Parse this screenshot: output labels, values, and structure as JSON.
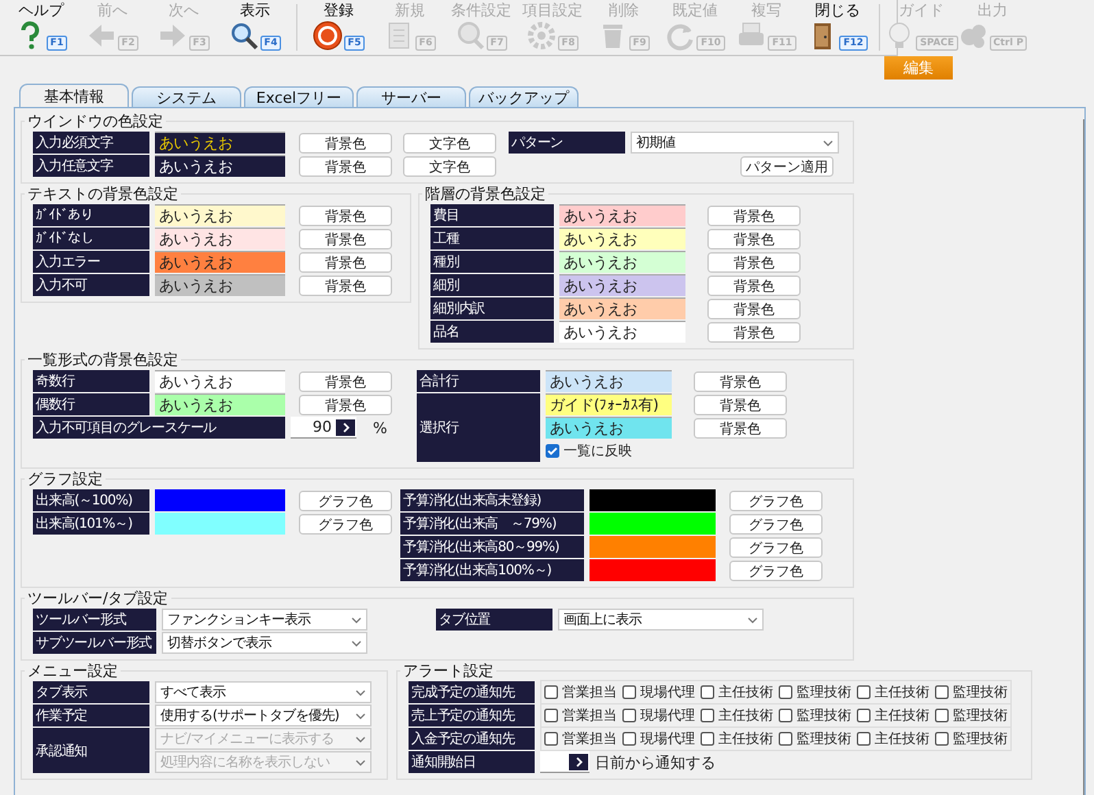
{
  "toolbar": {
    "groups": [
      [
        {
          "label": "ヘルプ",
          "key": "F1",
          "kind": "help",
          "disabled": false
        },
        {
          "label": "前へ",
          "key": "F2",
          "kind": "back",
          "disabled": true
        },
        {
          "label": "次へ",
          "key": "F3",
          "kind": "forward",
          "disabled": true
        },
        {
          "label": "表示",
          "key": "F4",
          "kind": "search",
          "disabled": false
        }
      ],
      [
        {
          "label": "登録",
          "key": "F5",
          "kind": "ok",
          "disabled": false
        },
        {
          "label": "新規",
          "key": "F6",
          "kind": "document",
          "disabled": true
        },
        {
          "label": "条件設定",
          "key": "F7",
          "kind": "filter",
          "disabled": true
        },
        {
          "label": "項目設定",
          "key": "F8",
          "kind": "gear",
          "disabled": true
        },
        {
          "label": "削除",
          "key": "F9",
          "kind": "trash",
          "disabled": true
        },
        {
          "label": "既定値",
          "key": "F10",
          "kind": "refresh",
          "disabled": true
        },
        {
          "label": "複写",
          "key": "F11",
          "kind": "copy",
          "disabled": true
        },
        {
          "label": "閉じる",
          "key": "F12",
          "kind": "close",
          "disabled": false
        }
      ],
      [
        {
          "label": "ガイド",
          "key": "SPACE",
          "kind": "bulb",
          "disabled": true
        },
        {
          "label": "出力",
          "key": "Ctrl P",
          "kind": "output",
          "disabled": true
        }
      ]
    ]
  },
  "mode_button": "編集",
  "tabs": [
    {
      "label": "基本情報",
      "selected": true
    },
    {
      "label": "システム",
      "selected": false
    },
    {
      "label": "Excelフリー",
      "selected": false
    },
    {
      "label": "サーバー",
      "selected": false
    },
    {
      "label": "バックアップ",
      "selected": false
    }
  ],
  "window_colors": {
    "title": "ウインドウの色設定",
    "rows": [
      {
        "label": "入力必須文字",
        "sample": "あいうえお",
        "kind": "required",
        "buttons": [
          "背景色",
          "文字色"
        ]
      },
      {
        "label": "入力任意文字",
        "sample": "あいうえお",
        "kind": "optional",
        "buttons": [
          "背景色",
          "文字色"
        ]
      }
    ],
    "pattern": {
      "label": "パターン",
      "value": "初期値",
      "apply": "パターン適用"
    }
  },
  "text_colors": {
    "title": "テキストの背景色設定",
    "rows": [
      {
        "label": "ｶﾞｲﾄﾞあり",
        "sample": "あいうえお",
        "color": "#fff8cc",
        "button": "背景色"
      },
      {
        "label": "ｶﾞｲﾄﾞなし",
        "sample": "あいうえお",
        "color": "#ffe4e4",
        "button": "背景色"
      },
      {
        "label": "入力エラー",
        "sample": "あいうえお",
        "color": "#ff8040",
        "button": "背景色"
      },
      {
        "label": "入力不可",
        "sample": "あいうえお",
        "color": "#c0c0c0",
        "button": "背景色"
      }
    ]
  },
  "level_colors": {
    "title": "階層の背景色設定",
    "rows": [
      {
        "label": "費目",
        "sample": "あいうえお",
        "color": "#ffcccc",
        "button": "背景色"
      },
      {
        "label": "工種",
        "sample": "あいうえお",
        "color": "#ffffbb",
        "button": "背景色"
      },
      {
        "label": "種別",
        "sample": "あいうえお",
        "color": "#d4ffd4",
        "button": "背景色"
      },
      {
        "label": "細別",
        "sample": "あいうえお",
        "color": "#ccc4ee",
        "button": "背景色"
      },
      {
        "label": "細別内訳",
        "sample": "あいうえお",
        "color": "#ffccaa",
        "button": "背景色"
      },
      {
        "label": "品名",
        "sample": "あいうえお",
        "color": "#ffffff",
        "button": "背景色"
      }
    ]
  },
  "list_colors": {
    "title": "一覧形式の背景色設定",
    "rows": [
      {
        "label": "奇数行",
        "sample": "あいうえお",
        "color": "#ffffff",
        "button": "背景色"
      },
      {
        "label": "偶数行",
        "sample": "あいうえお",
        "color": "#aaffaa",
        "button": "背景色"
      }
    ],
    "grayscale": {
      "label": "入力不可項目のグレースケール",
      "value": "90",
      "unit": "%"
    },
    "total": {
      "label": "合計行",
      "sample": "あいうえお",
      "color": "#cce4f8",
      "button": "背景色"
    },
    "selected_row": {
      "label": "選択行",
      "rows": [
        {
          "sample": "ガイド(ﾌｫｰｶｽ有)",
          "color": "#ffff80",
          "button": "背景色"
        },
        {
          "sample": "あいうえお",
          "color": "#70e4ee",
          "button": "背景色"
        }
      ],
      "reflect": {
        "label": "一覧に反映",
        "checked": true
      }
    }
  },
  "graph": {
    "title": "グラフ設定",
    "left": [
      {
        "label": "出来高(～100%)",
        "color": "#0000ff",
        "button": "グラフ色"
      },
      {
        "label": "出来高(101%～)",
        "color": "#80ffff",
        "button": "グラフ色"
      }
    ],
    "right": [
      {
        "label": "予算消化(出来高未登録)",
        "color": "#000000",
        "button": "グラフ色"
      },
      {
        "label": "予算消化(出来高　～79%)",
        "color": "#00ff00",
        "button": "グラフ色"
      },
      {
        "label": "予算消化(出来高80～99%)",
        "color": "#ff8000",
        "button": "グラフ色"
      },
      {
        "label": "予算消化(出来高100%～)",
        "color": "#ff0000",
        "button": "グラフ色"
      }
    ]
  },
  "toolbar_settings": {
    "title": "ツールバー/タブ設定",
    "rows": [
      {
        "label": "ツールバー形式",
        "value": "ファンクションキー表示"
      },
      {
        "label": "サブツールバー形式",
        "value": "切替ボタンで表示"
      }
    ],
    "tab_position": {
      "label": "タブ位置",
      "value": "画面上に表示"
    }
  },
  "menu_settings": {
    "title": "メニュー設定",
    "rows": [
      {
        "label": "タブ表示",
        "value": "すべて表示"
      },
      {
        "label": "作業予定",
        "value": "使用する(サポートタブを優先)"
      }
    ],
    "approval": {
      "label": "承認通知",
      "options": [
        {
          "value": "ナビ/マイメニューに表示する",
          "disabled": true
        },
        {
          "value": "処理内容に名称を表示しない",
          "disabled": true
        }
      ]
    }
  },
  "alert_settings": {
    "title": "アラート設定",
    "rows": [
      {
        "label": "完成予定の通知先",
        "options": [
          {
            "label": "営業担当",
            "checked": false
          },
          {
            "label": "現場代理",
            "checked": false
          },
          {
            "label": "主任技術",
            "checked": false
          },
          {
            "label": "監理技術",
            "checked": false
          },
          {
            "label": "主任技術",
            "checked": false
          },
          {
            "label": "監理技術",
            "checked": false
          }
        ]
      },
      {
        "label": "売上予定の通知先",
        "options": [
          {
            "label": "営業担当",
            "checked": false
          },
          {
            "label": "現場代理",
            "checked": false
          },
          {
            "label": "主任技術",
            "checked": false
          },
          {
            "label": "監理技術",
            "checked": false
          },
          {
            "label": "主任技術",
            "checked": false
          },
          {
            "label": "監理技術",
            "checked": false
          }
        ]
      },
      {
        "label": "入金予定の通知先",
        "options": [
          {
            "label": "営業担当",
            "checked": false
          },
          {
            "label": "現場代理",
            "checked": false
          },
          {
            "label": "主任技術",
            "checked": false
          },
          {
            "label": "監理技術",
            "checked": false
          },
          {
            "label": "主任技術",
            "checked": false
          },
          {
            "label": "監理技術",
            "checked": false
          }
        ]
      }
    ],
    "start": {
      "label": "通知開始日",
      "suffix": "日前から通知する"
    }
  }
}
